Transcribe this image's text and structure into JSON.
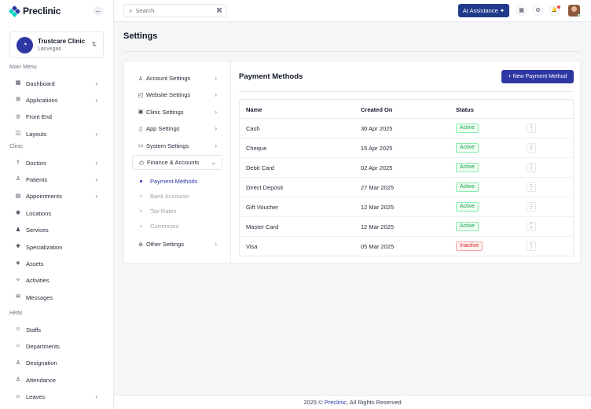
{
  "brand": {
    "name": "Preclinic",
    "collapse_icon": "←"
  },
  "clinic": {
    "name": "Trustcare Clinic",
    "location": "Lasvegas",
    "switch_icon": "⇅"
  },
  "sidebar": {
    "sections": [
      {
        "title": "Main Menu",
        "items": [
          {
            "label": "Dashboard",
            "icon": "▦",
            "chevron": "›"
          },
          {
            "label": "Applications",
            "icon": "⊞",
            "chevron": "›"
          },
          {
            "label": "Front End",
            "icon": "◎",
            "chevron": ""
          },
          {
            "label": "Layouts",
            "icon": "◫",
            "chevron": "›"
          }
        ]
      },
      {
        "title": "Clinic",
        "items": [
          {
            "label": "Doctors",
            "icon": "⚕",
            "chevron": "›"
          },
          {
            "label": "Patients",
            "icon": "♙",
            "chevron": "›"
          },
          {
            "label": "Appointments",
            "icon": "▤",
            "chevron": "›"
          },
          {
            "label": "Locations",
            "icon": "◉",
            "chevron": ""
          },
          {
            "label": "Services",
            "icon": "♟",
            "chevron": ""
          },
          {
            "label": "Specialization",
            "icon": "✚",
            "chevron": ""
          },
          {
            "label": "Assets",
            "icon": "◈",
            "chevron": ""
          },
          {
            "label": "Activities",
            "icon": "✧",
            "chevron": ""
          },
          {
            "label": "Messages",
            "icon": "✉",
            "chevron": ""
          }
        ]
      },
      {
        "title": "HRM",
        "items": [
          {
            "label": "Staffs",
            "icon": "☺",
            "chevron": ""
          },
          {
            "label": "Departments",
            "icon": "⌂",
            "chevron": ""
          },
          {
            "label": "Designation",
            "icon": "♙",
            "chevron": ""
          },
          {
            "label": "Attendance",
            "icon": "♙",
            "chevron": ""
          },
          {
            "label": "Leaves",
            "icon": "☺",
            "chevron": "›"
          }
        ]
      }
    ]
  },
  "topbar": {
    "search_placeholder": "Search",
    "search_shortcut": "⌘",
    "ai_label": "AI Assistance ✦",
    "icons": {
      "calendar": "▦",
      "settings": "⚙",
      "notifications": "🔔"
    }
  },
  "page": {
    "title": "Settings"
  },
  "settings_nav": {
    "items": [
      {
        "label": "Account Settings",
        "icon": "♙",
        "chevron": "›"
      },
      {
        "label": "Website Settings",
        "icon": "◰",
        "chevron": "›"
      },
      {
        "label": "Clinic Settings",
        "icon": "▣",
        "chevron": "›"
      },
      {
        "label": "App Settings",
        "icon": "▯",
        "chevron": "›"
      },
      {
        "label": "System Settings",
        "icon": "▭",
        "chevron": "›"
      },
      {
        "label": "Finance & Accounts",
        "icon": "◴",
        "chevron": "⌄"
      }
    ],
    "sub_items": [
      {
        "label": "Payment Methods",
        "active": true
      },
      {
        "label": "Bank Accounts",
        "active": false
      },
      {
        "label": "Tax Rates",
        "active": false
      },
      {
        "label": "Currencies",
        "active": false
      }
    ],
    "other": {
      "label": "Other Settings",
      "icon": "⊛",
      "chevron": "›"
    }
  },
  "payment_methods": {
    "title": "Payment Methods",
    "new_button": "+ New Payment Method",
    "columns": {
      "name": "Name",
      "created": "Created On",
      "status": "Status"
    },
    "rows": [
      {
        "name": "Cash",
        "created": "30 Apr 2025",
        "status": "Active"
      },
      {
        "name": "Cheque",
        "created": "15 Apr 2025",
        "status": "Active"
      },
      {
        "name": "Debit Card",
        "created": "02 Apr 2025",
        "status": "Active"
      },
      {
        "name": "Direct Deposit",
        "created": "27 Mar 2025",
        "status": "Active"
      },
      {
        "name": "Gift Voucher",
        "created": "12 Mar 2025",
        "status": "Active"
      },
      {
        "name": "Master Card",
        "created": "12 Mar 2025",
        "status": "Active"
      },
      {
        "name": "Visa",
        "created": "05 Mar 2025",
        "status": "Inactive"
      }
    ],
    "row_menu_icon": "⋮"
  },
  "footer": {
    "prefix": "2025 © ",
    "brand": "Preclinic",
    "suffix": ", All Rights Reserved"
  },
  "colors": {
    "accent": "#2e37a4",
    "ai_button": "#1f3a8a",
    "active": "#16a34a",
    "inactive": "#dc2626"
  }
}
